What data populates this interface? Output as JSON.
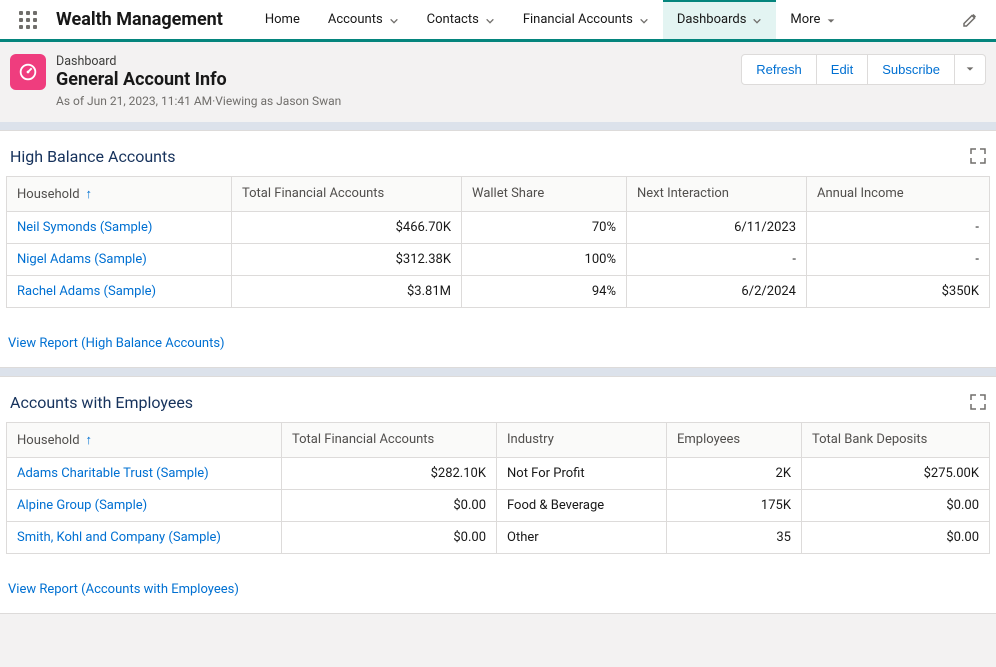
{
  "app": {
    "name": "Wealth Management"
  },
  "nav": {
    "home": "Home",
    "accounts": "Accounts",
    "contacts": "Contacts",
    "financial_accounts": "Financial Accounts",
    "dashboards": "Dashboards",
    "more": "More"
  },
  "header": {
    "breadcrumb": "Dashboard",
    "title": "General Account Info",
    "meta": "As of Jun 21, 2023, 11:41 AM·Viewing as Jason Swan",
    "refresh": "Refresh",
    "edit": "Edit",
    "subscribe": "Subscribe"
  },
  "comp1": {
    "title": "High Balance Accounts",
    "view_report": "View Report (High Balance Accounts)",
    "cols": {
      "household": "Household",
      "total_fa": "Total Financial Accounts",
      "wallet": "Wallet Share",
      "next": "Next Interaction",
      "income": "Annual Income"
    },
    "rows": [
      {
        "household": "Neil Symonds (Sample)",
        "total_fa": "$466.70K",
        "wallet": "70%",
        "next": "6/11/2023",
        "income": "-"
      },
      {
        "household": "Nigel Adams (Sample)",
        "total_fa": "$312.38K",
        "wallet": "100%",
        "next": "-",
        "income": "-"
      },
      {
        "household": "Rachel Adams (Sample)",
        "total_fa": "$3.81M",
        "wallet": "94%",
        "next": "6/2/2024",
        "income": "$350K"
      }
    ]
  },
  "comp2": {
    "title": "Accounts with Employees",
    "view_report": "View Report (Accounts with Employees)",
    "cols": {
      "household": "Household",
      "total_fa": "Total Financial Accounts",
      "industry": "Industry",
      "employees": "Employees",
      "deposits": "Total Bank Deposits"
    },
    "rows": [
      {
        "household": "Adams Charitable Trust (Sample)",
        "total_fa": "$282.10K",
        "industry": "Not For Profit",
        "employees": "2K",
        "deposits": "$275.00K"
      },
      {
        "household": "Alpine Group (Sample)",
        "total_fa": "$0.00",
        "industry": "Food & Beverage",
        "employees": "175K",
        "deposits": "$0.00"
      },
      {
        "household": "Smith, Kohl and Company (Sample)",
        "total_fa": "$0.00",
        "industry": "Other",
        "employees": "35",
        "deposits": "$0.00"
      }
    ]
  }
}
